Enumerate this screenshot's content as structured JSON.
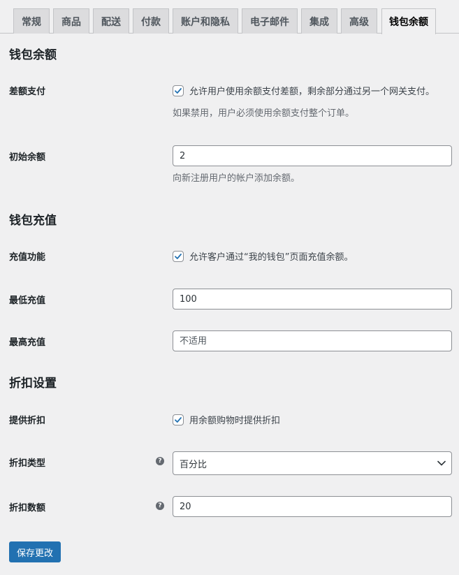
{
  "tabs": [
    {
      "label": "常规"
    },
    {
      "label": "商品"
    },
    {
      "label": "配送"
    },
    {
      "label": "付款"
    },
    {
      "label": "账户和隐私"
    },
    {
      "label": "电子邮件"
    },
    {
      "label": "集成"
    },
    {
      "label": "高级"
    },
    {
      "label": "钱包余额",
      "active": true
    }
  ],
  "section_wallet": {
    "title": "钱包余额",
    "diff_pay": {
      "label": "差额支付",
      "checkbox_text": "允许用户使用余额支付差额，剩余部分通过另一个网关支付。",
      "checked": true,
      "description": "如果禁用，用户必须使用余额支付整个订单。"
    },
    "initial_balance": {
      "label": "初始余额",
      "value": "2",
      "description": "向新注册用户的帐户添加余额。"
    }
  },
  "section_topup": {
    "title": "钱包充值",
    "topup": {
      "label": "充值功能",
      "checkbox_text": "允许客户通过“我的钱包”页面充值余额。",
      "checked": true
    },
    "min_topup": {
      "label": "最低充值",
      "value": "100"
    },
    "max_topup": {
      "label": "最高充值",
      "placeholder": "不适用"
    }
  },
  "section_discount": {
    "title": "折扣设置",
    "offer_discount": {
      "label": "提供折扣",
      "checkbox_text": "用余额购物时提供折扣",
      "checked": true
    },
    "discount_type": {
      "label": "折扣类型",
      "value": "百分比",
      "help": "?"
    },
    "discount_amount": {
      "label": "折扣数额",
      "value": "20",
      "help": "?"
    }
  },
  "save_button": "保存更改",
  "colors": {
    "primary": "#2271b1",
    "background": "#f0f0f1"
  }
}
